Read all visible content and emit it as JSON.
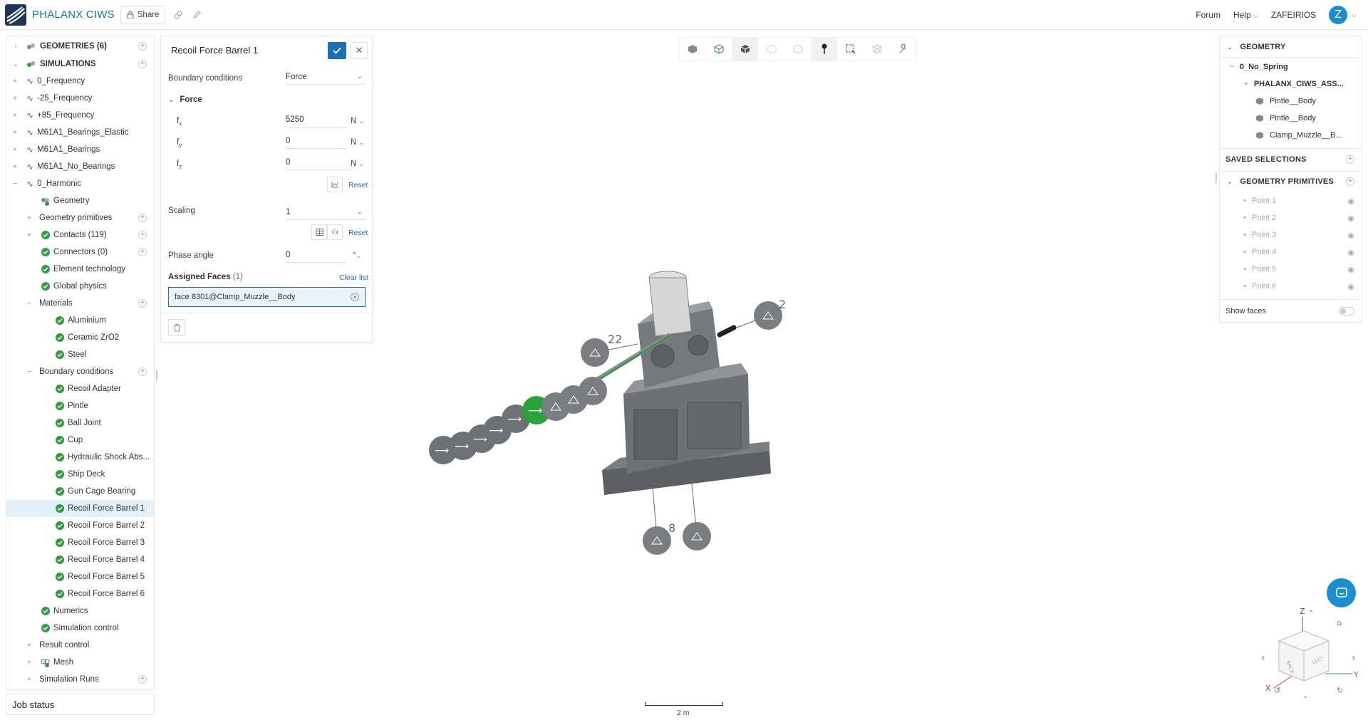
{
  "app": {
    "project_title": "PHALANX CIWS",
    "share_label": "Share",
    "nav": {
      "forum": "Forum",
      "help": "Help",
      "user": "ZAFEIRIOS",
      "avatar_letter": "Z"
    },
    "accent_color": "#1a6fb5"
  },
  "tree": {
    "geometries_label": "GEOMETRIES (6)",
    "simulations_label": "SIMULATIONS",
    "items": [
      {
        "label": "0_Frequency"
      },
      {
        "label": "-25_Frequency"
      },
      {
        "label": "+85_Frequency"
      },
      {
        "label": "M61A1_Bearings_Elastic"
      },
      {
        "label": "M61A1_Bearings"
      },
      {
        "label": "M61A1_No_Bearings"
      },
      {
        "label": "0_Harmonic"
      },
      {
        "label": "Geometry"
      },
      {
        "label": "Geometry primitives"
      },
      {
        "label": "Contacts (119)"
      },
      {
        "label": "Connectors (0)"
      },
      {
        "label": "Element technology"
      },
      {
        "label": "Global physics"
      },
      {
        "label": "Materials"
      },
      {
        "label": "Aluminium"
      },
      {
        "label": "Ceramic ZrO2"
      },
      {
        "label": "Steel"
      },
      {
        "label": "Boundary conditions"
      },
      {
        "label": "Recoil Adapter"
      },
      {
        "label": "Pintle"
      },
      {
        "label": "Ball Joint"
      },
      {
        "label": "Cup"
      },
      {
        "label": "Hydraulic Shock Abs..."
      },
      {
        "label": "Ship Deck"
      },
      {
        "label": "Gun Cage Bearing"
      },
      {
        "label": "Recoil Force Barrel 1"
      },
      {
        "label": "Recoil Force Barrel 2"
      },
      {
        "label": "Recoil Force Barrel 3"
      },
      {
        "label": "Recoil Force Barrel 4"
      },
      {
        "label": "Recoil Force Barrel 5"
      },
      {
        "label": "Recoil Force Barrel 6"
      },
      {
        "label": "Numerics"
      },
      {
        "label": "Simulation control"
      },
      {
        "label": "Result control"
      },
      {
        "label": "Mesh"
      },
      {
        "label": "Simulation Runs"
      }
    ],
    "job_status": "Job status"
  },
  "editor": {
    "title": "Recoil Force Barrel 1",
    "bc_label": "Boundary conditions",
    "bc_value": "Force",
    "force_section": "Force",
    "fx_label": "f",
    "fx_sub": "x",
    "fx_value": "5250",
    "fy_label": "f",
    "fy_sub": "y",
    "fy_value": "0",
    "fz_label": "f",
    "fz_sub": "z",
    "fz_value": "0",
    "unit": "N",
    "reset": "Reset",
    "scaling_label": "Scaling",
    "scaling_value": "1",
    "phase_label": "Phase angle",
    "phase_value": "0",
    "phase_unit": "°",
    "assigned_label": "Assigned Faces",
    "assigned_count": "(1)",
    "clear_list": "Clear list",
    "assigned_face": "face 8301@Clamp_Muzzle__Body"
  },
  "right_panel": {
    "geometry_head": "GEOMETRY",
    "geometry_root": "0_No_Spring",
    "assembly": "PHALANX_CIWS_ASS...",
    "parts": [
      "Pintle__Body",
      "Pintle__Body",
      "Clamp_Muzzle__B..."
    ],
    "saved_selections": "SAVED SELECTIONS",
    "primitives_head": "GEOMETRY PRIMITIVES",
    "points": [
      "Point 1",
      "Point 2",
      "Point 3",
      "Point 4",
      "Point 5",
      "Point 6"
    ],
    "show_faces": "Show faces"
  },
  "viewport": {
    "labels": {
      "a": "22",
      "b": "2",
      "c": "8"
    },
    "scale": "2 m",
    "cube_faces": {
      "back": "BACK",
      "left": "LEFT"
    },
    "axes": {
      "x": "X",
      "y": "Y",
      "z": "Z"
    }
  }
}
